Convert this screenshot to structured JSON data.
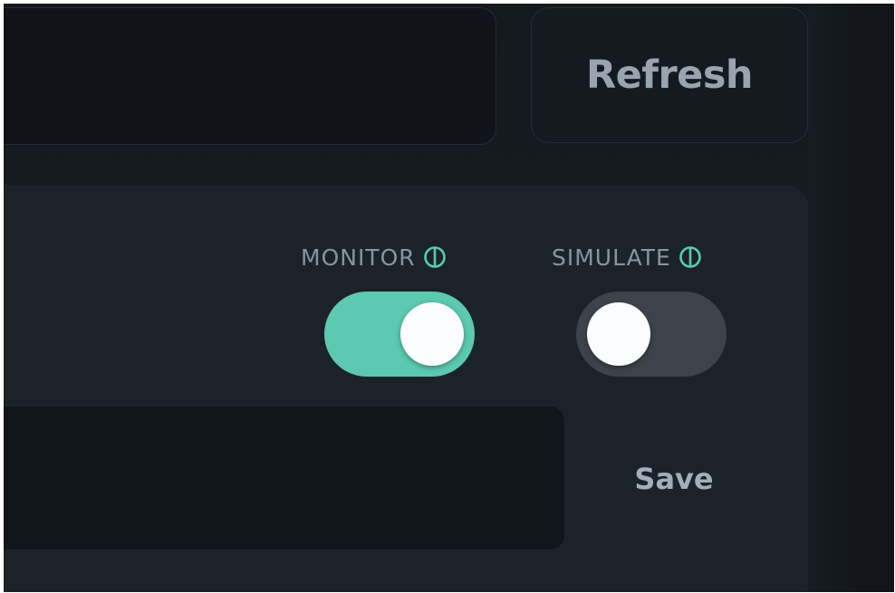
{
  "toolbar": {
    "refresh_label": "Refresh"
  },
  "settings": {
    "monitor": {
      "label": "MONITOR",
      "icon": "info-icon",
      "enabled": true
    },
    "simulate": {
      "label": "SIMULATE",
      "icon": "info-icon",
      "enabled": false
    },
    "save_label": "Save"
  },
  "colors": {
    "background": "#13171d",
    "panel": "#1c222a",
    "accent_on": "#5cc9b0",
    "toggle_off": "#3d434b",
    "label_text": "#8a939e",
    "info_icon": "#5cc9b0"
  }
}
